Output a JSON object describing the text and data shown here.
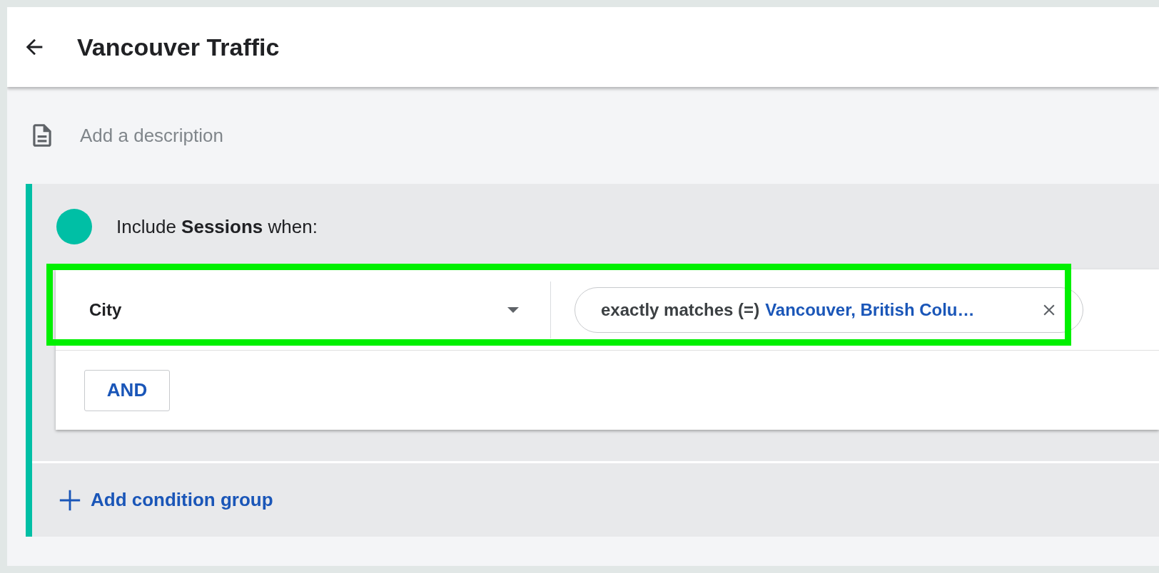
{
  "header": {
    "title": "Vancouver Traffic"
  },
  "description": {
    "placeholder": "Add a description"
  },
  "condition_group": {
    "intro": "Include **Sessions** when:",
    "conditions": [
      {
        "dimension": "City",
        "highlighted": true,
        "operator": "exactly matches (=)",
        "value": "Vancouver, British Colu…"
      }
    ],
    "and_button": "AND"
  },
  "add_group": "Add condition group"
}
